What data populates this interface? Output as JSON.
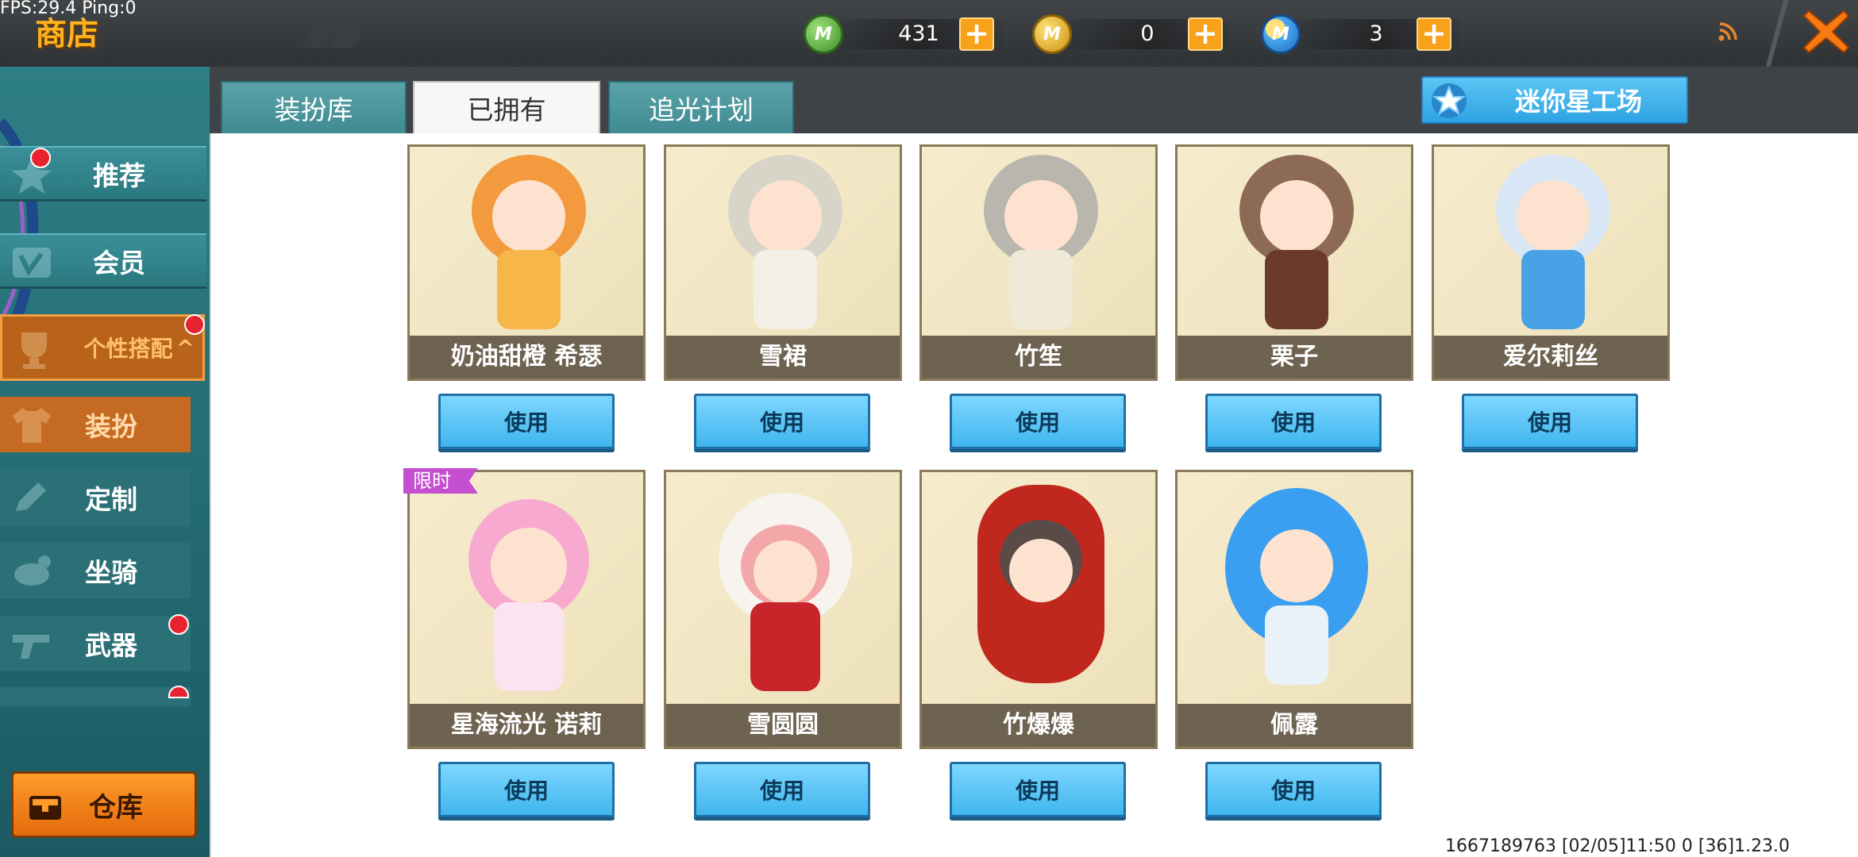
{
  "debug": {
    "fps_ping": "FPS:29.4  Ping:0"
  },
  "header": {
    "title": "商店",
    "currencies": [
      {
        "icon": "green-gem-icon",
        "letter": "M",
        "value": "431",
        "color": "#4fa83a"
      },
      {
        "icon": "gold-coin-icon",
        "letter": "M",
        "value": "0",
        "color": "#e2b21c"
      },
      {
        "icon": "blue-coin-icon",
        "letter": "M",
        "value": "3",
        "color": "#2e8fe0"
      }
    ]
  },
  "sidebar": {
    "items": [
      {
        "label": "推荐",
        "badge": true
      },
      {
        "label": "会员",
        "badge": false
      }
    ],
    "category": {
      "label": "个性搭配",
      "arrow": "^",
      "badge": true
    },
    "sub_items": [
      {
        "label": "装扮",
        "selected": true
      },
      {
        "label": "定制",
        "badge": false
      },
      {
        "label": "坐骑",
        "badge": false
      },
      {
        "label": "武器",
        "badge": true
      }
    ],
    "warehouse_label": "仓库"
  },
  "tabs": [
    {
      "label": "装扮库",
      "active": false
    },
    {
      "label": "已拥有",
      "active": true
    },
    {
      "label": "追光计划",
      "active": false
    }
  ],
  "workshop_button": "迷你星工场",
  "items": [
    {
      "name": "奶油甜橙 希瑟",
      "button": "使用",
      "hair": "#f39a3e",
      "outfit": "#f7b64a"
    },
    {
      "name": "雪裙",
      "button": "使用",
      "hair": "#d8d4c8",
      "outfit": "#f2efe6"
    },
    {
      "name": "竹笙",
      "button": "使用",
      "hair": "#b9b6ae",
      "outfit": "#efe9d8"
    },
    {
      "name": "栗子",
      "button": "使用",
      "hair": "#8d6a55",
      "outfit": "#6b3a2a"
    },
    {
      "name": "爱尔莉丝",
      "button": "使用",
      "hair": "#d8e6f5",
      "outfit": "#4aa2e6"
    },
    {
      "name": "星海流光 诺莉",
      "button": "使用",
      "hair": "#f7a9cf",
      "outfit": "#fbe3f0",
      "tag": "限时"
    },
    {
      "name": "雪圆圆",
      "button": "使用",
      "hair": "#f4a7a8",
      "outfit": "#c8252a"
    },
    {
      "name": "竹爆爆",
      "button": "使用",
      "hair": "#5a4a48",
      "outfit": "#c0281e"
    },
    {
      "name": "佩露",
      "button": "使用",
      "hair": "#3a9ff0",
      "outfit": "#e9f2f8"
    }
  ],
  "footer": {
    "info": "1667189763   [02/05]11:50 0   [36]1.23.0"
  }
}
